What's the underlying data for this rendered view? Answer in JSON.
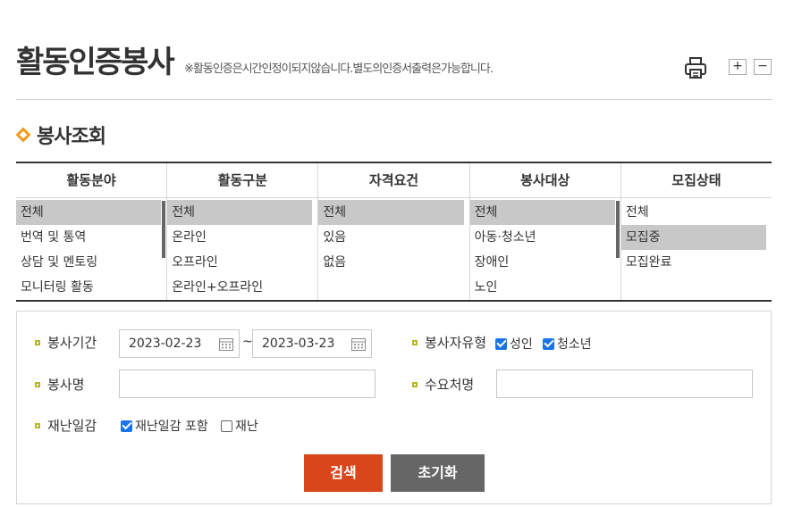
{
  "page": {
    "title": "활동인증봉사",
    "note": "※활동인증은시간인정이되지않습니다.별도의인증서출력은가능합니다.",
    "zoom_in": "+",
    "zoom_out": "−"
  },
  "section": {
    "title": "봉사조회"
  },
  "filters": [
    {
      "header": "활동분야",
      "items": [
        "전체",
        "번역 및 통역",
        "상담 및 멘토링",
        "모니터링 활동"
      ],
      "selected": 0,
      "scrollbar": true
    },
    {
      "header": "활동구분",
      "items": [
        "전체",
        "온라인",
        "오프라인",
        "온라인+오프라인"
      ],
      "selected": 0,
      "scrollbar": false
    },
    {
      "header": "자격요건",
      "items": [
        "전체",
        "있음",
        "없음"
      ],
      "selected": 0,
      "scrollbar": false
    },
    {
      "header": "봉사대상",
      "items": [
        "전체",
        "아동·청소년",
        "장애인",
        "노인"
      ],
      "selected": 0,
      "scrollbar": true
    },
    {
      "header": "모집상태",
      "items": [
        "전체",
        "모집중",
        "모집완료"
      ],
      "selected": 1,
      "scrollbar": false
    }
  ],
  "search": {
    "period_label": "봉사기간",
    "date_from": "2023-02-23",
    "tilde": "~",
    "date_to": "2023-03-23",
    "volunteer_type_label": "봉사자유형",
    "type_adult": "성인",
    "type_youth": "청소년",
    "name_label": "봉사명",
    "name_value": "",
    "demand_label": "수요처명",
    "demand_value": "",
    "disaster_label": "재난일감",
    "disaster_include": "재난일감 포함",
    "disaster_only": "재난",
    "search_button": "검색",
    "reset_button": "초기화"
  }
}
